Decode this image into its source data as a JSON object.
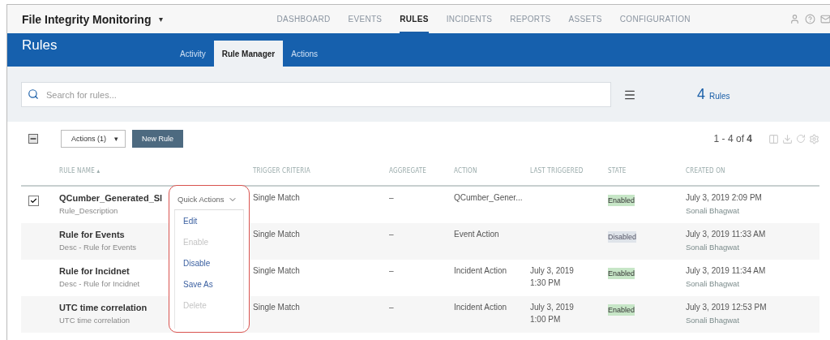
{
  "app": {
    "title": "File Integrity Monitoring",
    "menu_caret": "▾"
  },
  "nav": [
    {
      "label": "DASHBOARD",
      "selected": false
    },
    {
      "label": "EVENTS",
      "selected": false
    },
    {
      "label": "RULES",
      "selected": true
    },
    {
      "label": "INCIDENTS",
      "selected": false
    },
    {
      "label": "REPORTS",
      "selected": false
    },
    {
      "label": "ASSETS",
      "selected": false
    },
    {
      "label": "CONFIGURATION",
      "selected": false
    }
  ],
  "page": {
    "title": "Rules"
  },
  "tabs": [
    {
      "label": "Activity",
      "selected": false
    },
    {
      "label": "Rule Manager",
      "selected": true
    },
    {
      "label": "Actions",
      "selected": false
    }
  ],
  "search": {
    "placeholder": "Search for rules..."
  },
  "count": {
    "value": "4",
    "label": "Rules"
  },
  "toolbar": {
    "select_all_partial": true,
    "actions": "Actions (1)",
    "actions_caret": "▾",
    "new_rule": "New Rule"
  },
  "pagination": {
    "range": "1 - 4 of",
    "total": "4"
  },
  "table": {
    "columns": [
      "RULE NAME",
      "TRIGGER CRITERIA",
      "AGGREGATE",
      "ACTION",
      "LAST TRIGGERED",
      "STATE",
      "CREATED ON"
    ],
    "sort_mark": "▴",
    "rows": [
      {
        "selected": true,
        "name": "QCumber_Generated_Sl",
        "desc": "Rule_Description",
        "trigger": "Single Match",
        "aggregate": "–",
        "action": "QCumber_Gener...",
        "last": "",
        "state": "Enabled",
        "enabled": true,
        "created": "July 3, 2019 2:09 PM",
        "author": "Sonali Bhagwat"
      },
      {
        "selected": false,
        "name": "Rule for Events",
        "desc": "Desc - Rule for Events",
        "trigger": "Single Match",
        "aggregate": "–",
        "action": "Event Action",
        "last": "",
        "state": "Disabled",
        "enabled": false,
        "created": "July 3, 2019 11:33 AM",
        "author": "Sonali Bhagwat"
      },
      {
        "selected": false,
        "name": "Rule for Incidnet",
        "desc": "Desc - Rule for Incidnet",
        "trigger": "Single Match",
        "aggregate": "–",
        "action": "Incident Action",
        "last": "July 3, 2019\n1:30 PM",
        "state": "Enabled",
        "enabled": true,
        "created": "July 3, 2019 11:34 AM",
        "author": "Sonali Bhagwat"
      },
      {
        "selected": false,
        "name": "UTC time correlation",
        "desc": "UTC time correlation",
        "trigger": "Single Match",
        "aggregate": "–",
        "action": "Incident Action",
        "last": "July 3, 2019\n1:00 PM",
        "state": "Enabled",
        "enabled": true,
        "created": "July 3, 2019 12:53 PM",
        "author": "Sonali Bhagwat"
      }
    ]
  },
  "quick_actions": {
    "label": "Quick Actions",
    "items": [
      {
        "label": "Edit",
        "disabled": false
      },
      {
        "label": "Enable",
        "disabled": true
      },
      {
        "label": "Disable",
        "disabled": false
      },
      {
        "label": "Save As",
        "disabled": false
      },
      {
        "label": "Delete",
        "disabled": true
      }
    ]
  }
}
